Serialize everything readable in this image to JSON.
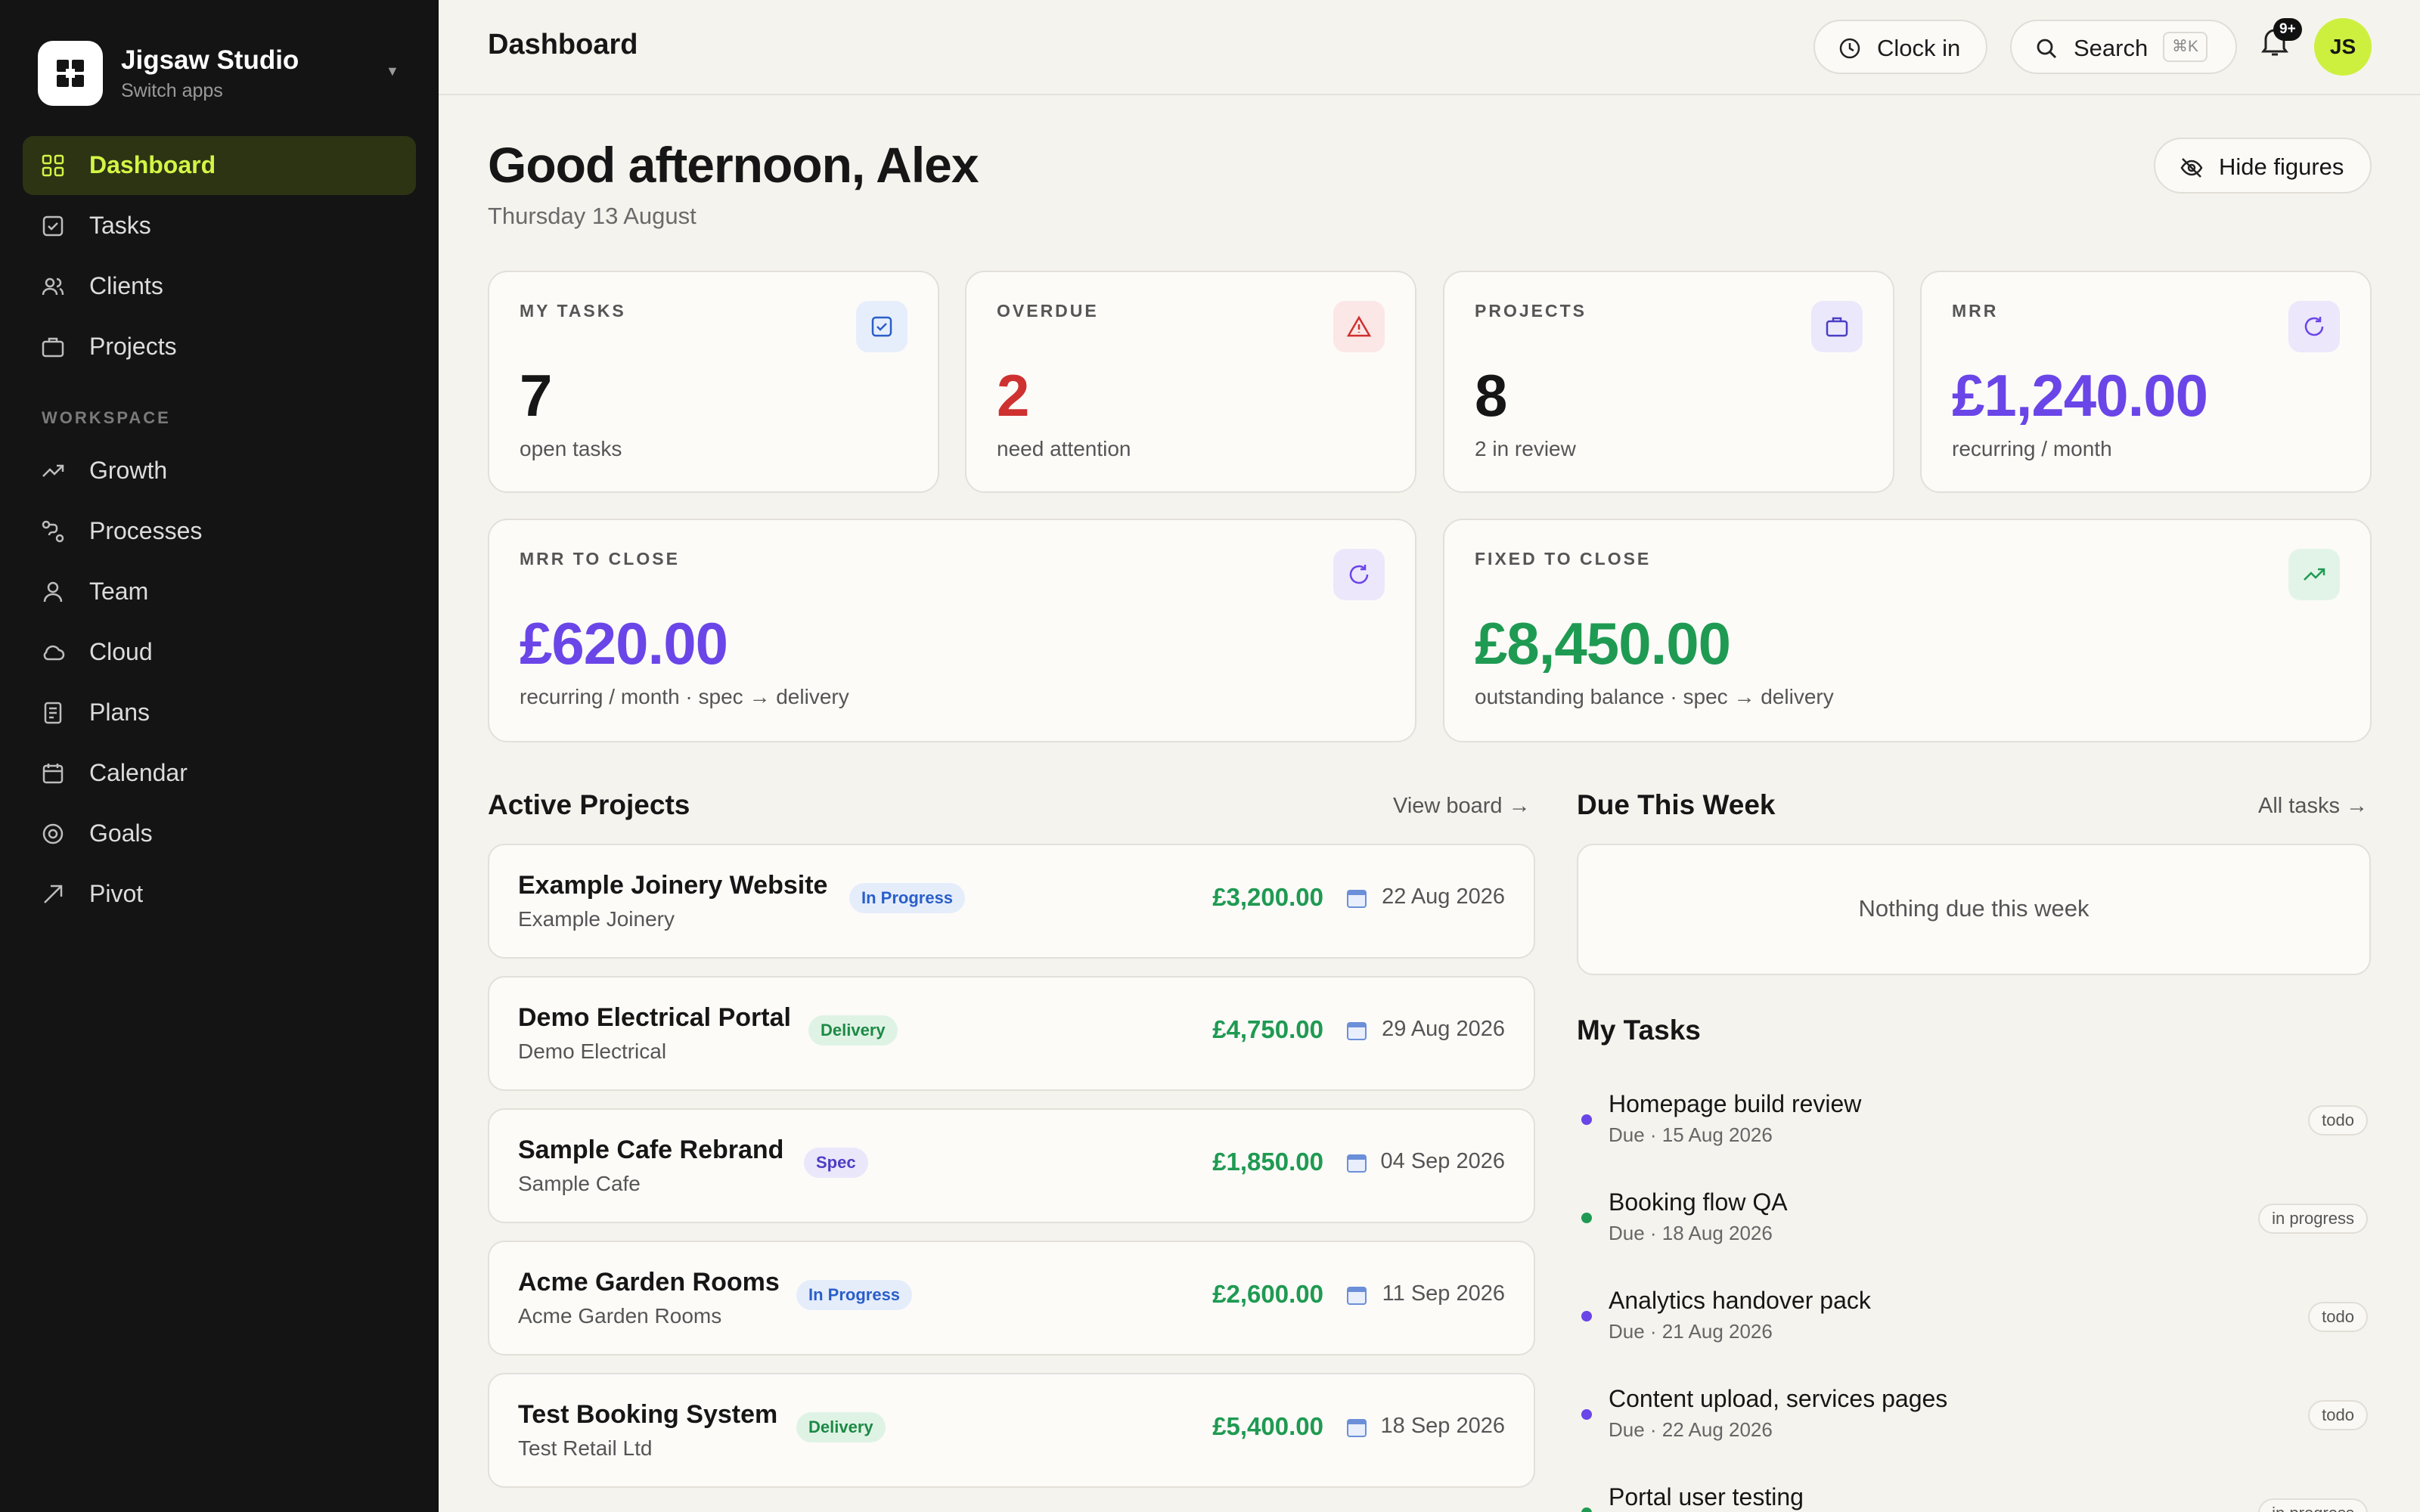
{
  "sidebar": {
    "brand": {
      "name": "Jigsaw Studio",
      "sub": "Switch apps"
    },
    "items": [
      {
        "label": "Dashboard",
        "icon": "grid-icon"
      },
      {
        "label": "Tasks",
        "icon": "checkbox-icon"
      },
      {
        "label": "Clients",
        "icon": "users-icon"
      },
      {
        "label": "Projects",
        "icon": "briefcase-icon"
      }
    ],
    "section": "WORKSPACE",
    "workspace": [
      {
        "label": "Growth",
        "icon": "trend-icon"
      },
      {
        "label": "Processes",
        "icon": "flow-icon"
      },
      {
        "label": "Team",
        "icon": "user-icon"
      },
      {
        "label": "Cloud",
        "icon": "cloud-icon"
      },
      {
        "label": "Plans",
        "icon": "document-icon"
      },
      {
        "label": "Calendar",
        "icon": "calendar-icon"
      },
      {
        "label": "Goals",
        "icon": "target-icon"
      },
      {
        "label": "Pivot",
        "icon": "arrow-up-right-icon"
      }
    ]
  },
  "header": {
    "title": "Dashboard",
    "clock_in": "Clock in",
    "search": "Search",
    "search_kbd": "⌘K",
    "notif_count": "9+",
    "avatar": "JS"
  },
  "greeting": {
    "text": "Good afternoon, Alex",
    "date": "Thursday 13 August",
    "hide_btn": "Hide figures"
  },
  "stats": [
    {
      "label": "MY TASKS",
      "value": "7",
      "sub": "open tasks",
      "color": "#161616",
      "icon": "checkbox-icon"
    },
    {
      "label": "OVERDUE",
      "value": "2",
      "sub": "need attention",
      "color": "#cf3030",
      "icon": "warning-icon"
    },
    {
      "label": "PROJECTS",
      "value": "8",
      "sub": "2 in review",
      "color": "#161616",
      "icon": "briefcase-icon"
    },
    {
      "label": "MRR",
      "value": "£1,240.00",
      "sub": "recurring / month",
      "color": "#6a45e8",
      "icon": "refresh-icon"
    },
    {
      "label": "MRR TO CLOSE",
      "value": "£620.00",
      "sub": "recurring / month · spec → delivery",
      "color": "#6a45e8",
      "icon": "refresh-icon"
    },
    {
      "label": "FIXED TO CLOSE",
      "value": "£8,450.00",
      "sub": "outstanding balance · spec → delivery",
      "color": "#1f9a52",
      "icon": "trend-icon"
    }
  ],
  "active_projects": {
    "title": "Active Projects",
    "link": "View board →",
    "items": [
      {
        "name": "Example Joinery Website",
        "client": "Example Joinery",
        "status": "In Progress",
        "amount": "£3,200.00",
        "date": "22 Aug 2026"
      },
      {
        "name": "Demo Electrical Portal",
        "client": "Demo Electrical",
        "status": "Delivery",
        "amount": "£4,750.00",
        "date": "29 Aug 2026"
      },
      {
        "name": "Sample Cafe Rebrand",
        "client": "Sample Cafe",
        "status": "Spec",
        "amount": "£1,850.00",
        "date": "04 Sep 2026"
      },
      {
        "name": "Acme Garden Rooms",
        "client": "Acme Garden Rooms",
        "status": "In Progress",
        "amount": "£2,600.00",
        "date": "11 Sep 2026"
      },
      {
        "name": "Test Booking System",
        "client": "Test Retail Ltd",
        "status": "Delivery",
        "amount": "£5,400.00",
        "date": "18 Sep 2026"
      }
    ]
  },
  "due_week": {
    "title": "Due This Week",
    "link": "All tasks →",
    "empty": "Nothing due this week"
  },
  "my_tasks": {
    "title": "My Tasks",
    "items": [
      {
        "name": "Homepage build review",
        "due": "Due · 15 Aug 2026",
        "status": "todo",
        "dot": "#6a45e8"
      },
      {
        "name": "Booking flow QA",
        "due": "Due · 18 Aug 2026",
        "status": "in progress",
        "dot": "#1f9a52"
      },
      {
        "name": "Analytics handover pack",
        "due": "Due · 21 Aug 2026",
        "status": "todo",
        "dot": "#6a45e8"
      },
      {
        "name": "Content upload, services pages",
        "due": "Due · 22 Aug 2026",
        "status": "todo",
        "dot": "#6a45e8"
      },
      {
        "name": "Portal user testing",
        "due": "",
        "status": "in progress",
        "dot": "#1f9a52"
      }
    ]
  }
}
